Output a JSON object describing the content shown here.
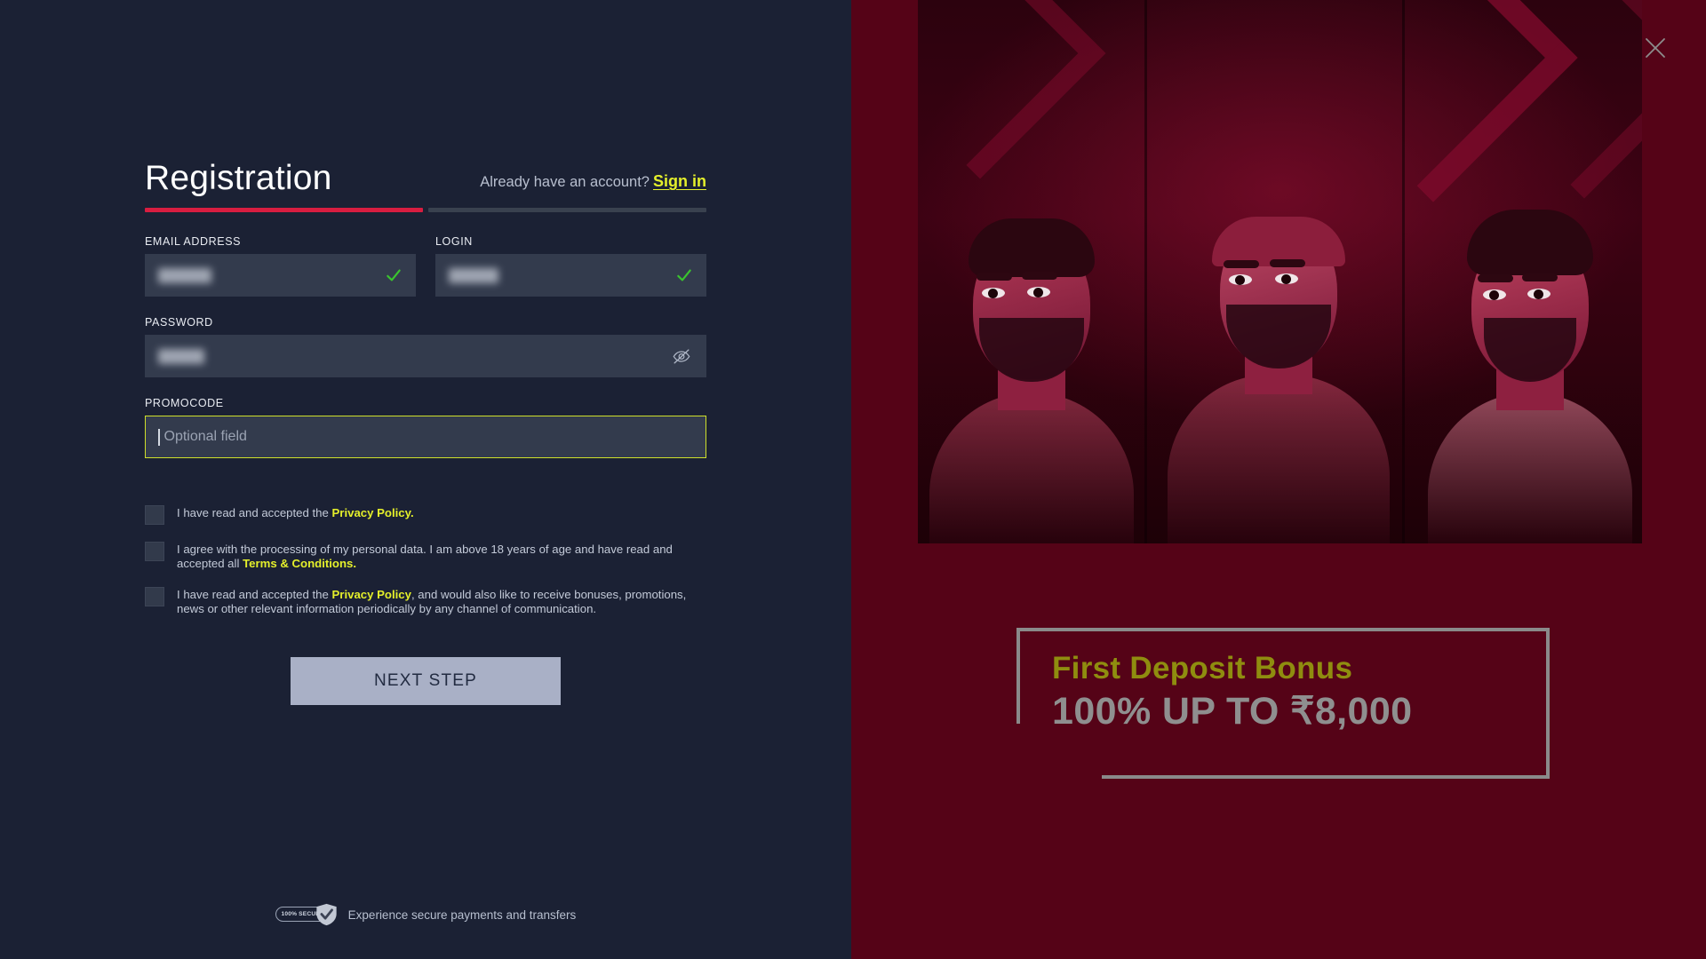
{
  "window": {
    "close_icon": "close-icon"
  },
  "registration": {
    "title": "Registration",
    "already_have_account": "Already have an account?",
    "sign_in_label": "Sign in",
    "progress": {
      "active_step": 1,
      "total_steps": 2,
      "active_color": "#d81d40",
      "inactive_color": "#39414f"
    },
    "fields": {
      "email": {
        "label": "EMAIL ADDRESS",
        "value": "",
        "placeholder": "",
        "valid": true,
        "valid_icon": "check-icon"
      },
      "login": {
        "label": "LOGIN",
        "value": "",
        "placeholder": "",
        "valid": true,
        "valid_icon": "check-icon"
      },
      "password": {
        "label": "PASSWORD",
        "value": "",
        "placeholder": "",
        "toggle_icon": "eye-off-icon"
      },
      "promocode": {
        "label": "PROMOCODE",
        "value": "",
        "placeholder": "Optional field",
        "focused": true,
        "focus_color": "#cfe02a"
      }
    },
    "agreements": [
      {
        "id": "privacy-policy",
        "checked": false,
        "text_before": "I have read and accepted the",
        "link": "Privacy Policy.",
        "text_after": ""
      },
      {
        "id": "terms-conditions",
        "checked": false,
        "text_before": "I agree with the processing of my personal data. I am above 18 years of age and have read and accepted all",
        "link": "Terms & Conditions.",
        "text_after": ""
      },
      {
        "id": "marketing-optin",
        "checked": false,
        "text_before": "I have read and accepted the",
        "link": "Privacy Policy",
        "text_after": ", and would also like to receive bonuses, promotions, news or other relevant information periodically by any channel of communication."
      }
    ],
    "next_button": "NEXT STEP",
    "secure": {
      "badge_label": "100% SECURE",
      "badge_icon": "shield-check-icon",
      "text": "Experience secure payments and transfers"
    }
  },
  "promo": {
    "hero_alt": "three-cricket-players-artwork",
    "bonus_title": "First Deposit Bonus",
    "bonus_amount": "100% UP TO ₹8,000",
    "title_color": "#8f8d0f",
    "amount_color": "#8f8f8f"
  },
  "theme": {
    "left_bg": "#1b2134",
    "right_bg": "#550317",
    "input_bg": "#333b4d",
    "link_yellow": "#e4ef2b",
    "check_green": "#3ac42e",
    "button_bg": "#a9b0c6"
  }
}
